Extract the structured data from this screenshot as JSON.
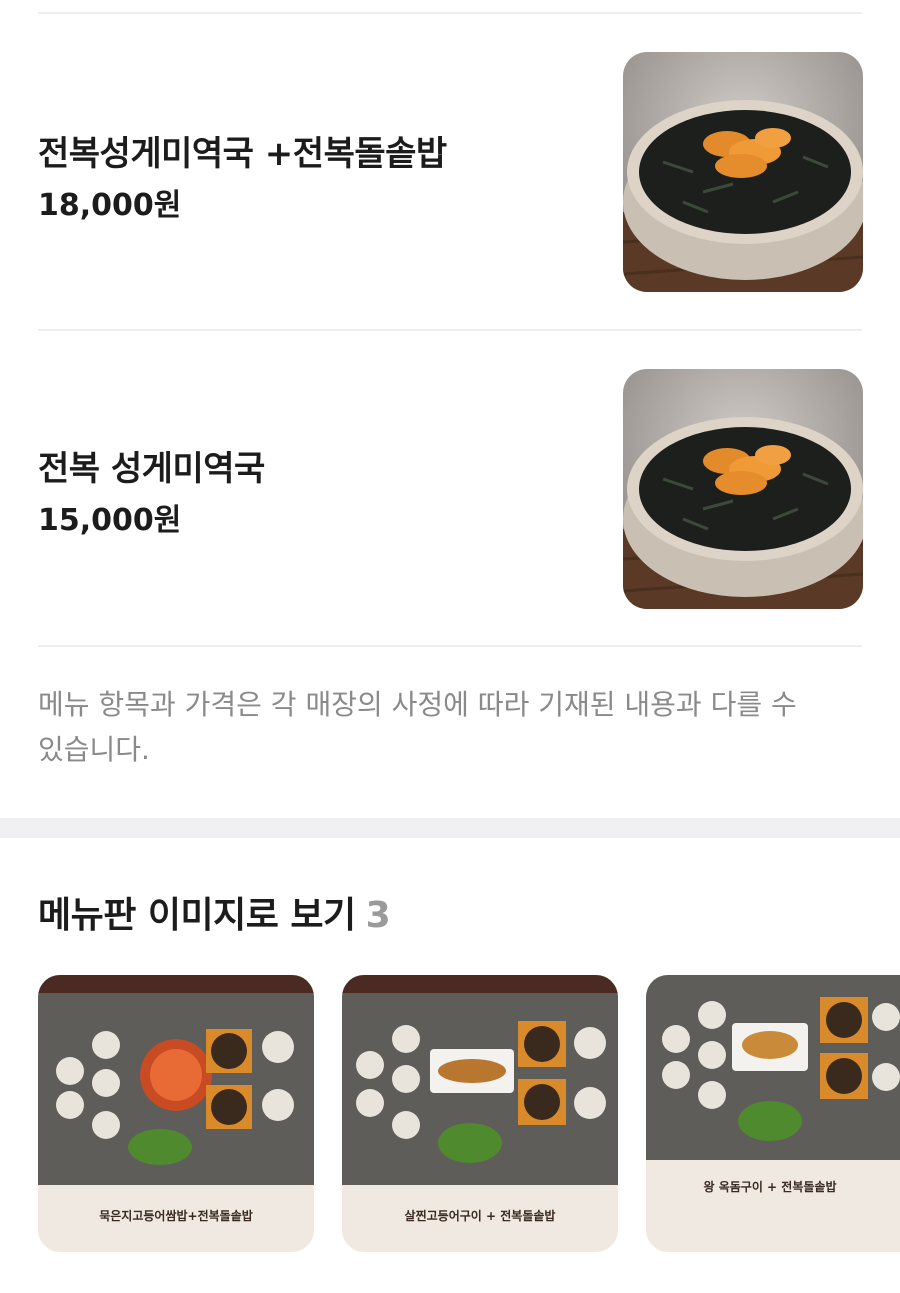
{
  "menu_items": [
    {
      "name": "전복성게미역국 +전복돌솥밥",
      "price": "18,000원",
      "image_icon": "seaweed-soup-photo"
    },
    {
      "name": "전복 성게미역국",
      "price": "15,000원",
      "image_icon": "seaweed-soup-photo"
    }
  ],
  "notice": "메뉴 항목과 가격은 각 매장의 사정에 따라 기재된 내용과 다를 수 있습니다.",
  "menu_board_section": {
    "title": "메뉴판 이미지로 보기",
    "count": "3",
    "boards": [
      {
        "caption": "묵은지고등어쌈밥+전복돌솥밥"
      },
      {
        "caption": "살찐고등어구이 + 전복돌솥밥"
      },
      {
        "caption": "왕 옥돔구이 + 전복돌솥밥"
      }
    ]
  },
  "colors": {
    "text_primary": "#1c1c1c",
    "text_secondary": "#8a8a8a",
    "count_gray": "#9a9a9a",
    "divider": "#eeeeee",
    "section_gap": "#f0f0f2",
    "board_header": "#4a2a22",
    "board_table": "#5e5d5a",
    "board_footer": "#efe9e2"
  }
}
